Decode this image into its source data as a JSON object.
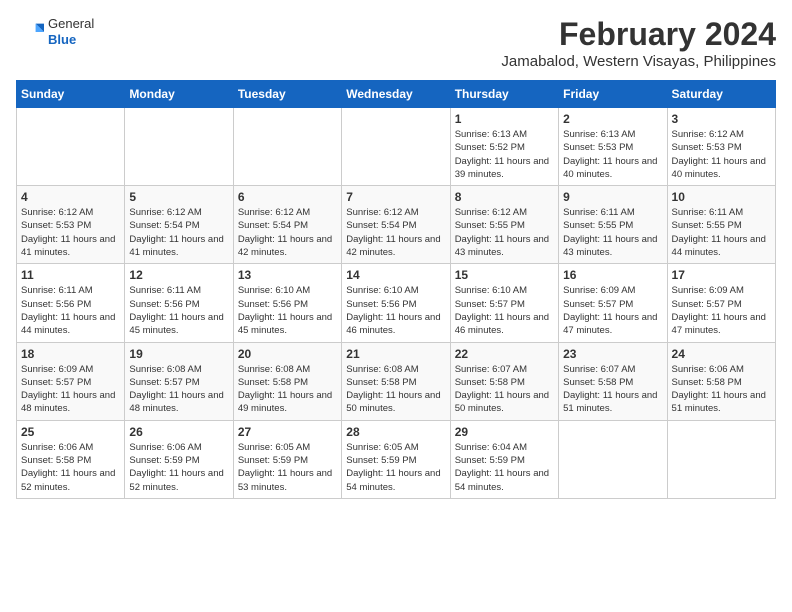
{
  "header": {
    "logo_general": "General",
    "logo_blue": "Blue",
    "main_title": "February 2024",
    "subtitle": "Jamabalod, Western Visayas, Philippines"
  },
  "calendar": {
    "days_of_week": [
      "Sunday",
      "Monday",
      "Tuesday",
      "Wednesday",
      "Thursday",
      "Friday",
      "Saturday"
    ],
    "weeks": [
      [
        {
          "day": "",
          "info": ""
        },
        {
          "day": "",
          "info": ""
        },
        {
          "day": "",
          "info": ""
        },
        {
          "day": "",
          "info": ""
        },
        {
          "day": "1",
          "info": "Sunrise: 6:13 AM\nSunset: 5:52 PM\nDaylight: 11 hours and 39 minutes."
        },
        {
          "day": "2",
          "info": "Sunrise: 6:13 AM\nSunset: 5:53 PM\nDaylight: 11 hours and 40 minutes."
        },
        {
          "day": "3",
          "info": "Sunrise: 6:12 AM\nSunset: 5:53 PM\nDaylight: 11 hours and 40 minutes."
        }
      ],
      [
        {
          "day": "4",
          "info": "Sunrise: 6:12 AM\nSunset: 5:53 PM\nDaylight: 11 hours and 41 minutes."
        },
        {
          "day": "5",
          "info": "Sunrise: 6:12 AM\nSunset: 5:54 PM\nDaylight: 11 hours and 41 minutes."
        },
        {
          "day": "6",
          "info": "Sunrise: 6:12 AM\nSunset: 5:54 PM\nDaylight: 11 hours and 42 minutes."
        },
        {
          "day": "7",
          "info": "Sunrise: 6:12 AM\nSunset: 5:54 PM\nDaylight: 11 hours and 42 minutes."
        },
        {
          "day": "8",
          "info": "Sunrise: 6:12 AM\nSunset: 5:55 PM\nDaylight: 11 hours and 43 minutes."
        },
        {
          "day": "9",
          "info": "Sunrise: 6:11 AM\nSunset: 5:55 PM\nDaylight: 11 hours and 43 minutes."
        },
        {
          "day": "10",
          "info": "Sunrise: 6:11 AM\nSunset: 5:55 PM\nDaylight: 11 hours and 44 minutes."
        }
      ],
      [
        {
          "day": "11",
          "info": "Sunrise: 6:11 AM\nSunset: 5:56 PM\nDaylight: 11 hours and 44 minutes."
        },
        {
          "day": "12",
          "info": "Sunrise: 6:11 AM\nSunset: 5:56 PM\nDaylight: 11 hours and 45 minutes."
        },
        {
          "day": "13",
          "info": "Sunrise: 6:10 AM\nSunset: 5:56 PM\nDaylight: 11 hours and 45 minutes."
        },
        {
          "day": "14",
          "info": "Sunrise: 6:10 AM\nSunset: 5:56 PM\nDaylight: 11 hours and 46 minutes."
        },
        {
          "day": "15",
          "info": "Sunrise: 6:10 AM\nSunset: 5:57 PM\nDaylight: 11 hours and 46 minutes."
        },
        {
          "day": "16",
          "info": "Sunrise: 6:09 AM\nSunset: 5:57 PM\nDaylight: 11 hours and 47 minutes."
        },
        {
          "day": "17",
          "info": "Sunrise: 6:09 AM\nSunset: 5:57 PM\nDaylight: 11 hours and 47 minutes."
        }
      ],
      [
        {
          "day": "18",
          "info": "Sunrise: 6:09 AM\nSunset: 5:57 PM\nDaylight: 11 hours and 48 minutes."
        },
        {
          "day": "19",
          "info": "Sunrise: 6:08 AM\nSunset: 5:57 PM\nDaylight: 11 hours and 48 minutes."
        },
        {
          "day": "20",
          "info": "Sunrise: 6:08 AM\nSunset: 5:58 PM\nDaylight: 11 hours and 49 minutes."
        },
        {
          "day": "21",
          "info": "Sunrise: 6:08 AM\nSunset: 5:58 PM\nDaylight: 11 hours and 50 minutes."
        },
        {
          "day": "22",
          "info": "Sunrise: 6:07 AM\nSunset: 5:58 PM\nDaylight: 11 hours and 50 minutes."
        },
        {
          "day": "23",
          "info": "Sunrise: 6:07 AM\nSunset: 5:58 PM\nDaylight: 11 hours and 51 minutes."
        },
        {
          "day": "24",
          "info": "Sunrise: 6:06 AM\nSunset: 5:58 PM\nDaylight: 11 hours and 51 minutes."
        }
      ],
      [
        {
          "day": "25",
          "info": "Sunrise: 6:06 AM\nSunset: 5:58 PM\nDaylight: 11 hours and 52 minutes."
        },
        {
          "day": "26",
          "info": "Sunrise: 6:06 AM\nSunset: 5:59 PM\nDaylight: 11 hours and 52 minutes."
        },
        {
          "day": "27",
          "info": "Sunrise: 6:05 AM\nSunset: 5:59 PM\nDaylight: 11 hours and 53 minutes."
        },
        {
          "day": "28",
          "info": "Sunrise: 6:05 AM\nSunset: 5:59 PM\nDaylight: 11 hours and 54 minutes."
        },
        {
          "day": "29",
          "info": "Sunrise: 6:04 AM\nSunset: 5:59 PM\nDaylight: 11 hours and 54 minutes."
        },
        {
          "day": "",
          "info": ""
        },
        {
          "day": "",
          "info": ""
        }
      ]
    ]
  }
}
